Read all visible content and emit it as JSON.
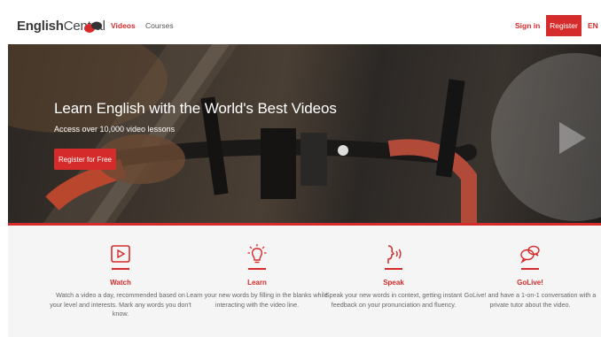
{
  "header": {
    "logo_bold": "English",
    "logo_light": "Central",
    "nav": [
      "Videos",
      "Courses"
    ],
    "sign_in": "Sign in",
    "register": "Register",
    "language": "EN"
  },
  "hero": {
    "title": "Learn English with the World's Best Videos",
    "subtitle": "Access over 10,000 video lessons",
    "cta": "Register for Free"
  },
  "features": [
    {
      "icon": "play-icon",
      "title": "Watch",
      "description": "Watch a video a day, recommended based on your level and interests. Mark any words you don't know."
    },
    {
      "icon": "lightbulb-icon",
      "title": "Learn",
      "description": "Learn your new words by filling in the blanks while interacting with the video line."
    },
    {
      "icon": "speaking-icon",
      "title": "Speak",
      "description": "Speak your new words in context, getting instant feedback on your pronunciation and fluency."
    },
    {
      "icon": "chat-bubbles-icon",
      "title": "GoLive!",
      "description": "GoLive! and have a 1-on-1 conversation with a private tutor about the video."
    }
  ],
  "colors": {
    "accent": "#d52b2b",
    "feature_bg": "#f5f5f5"
  }
}
